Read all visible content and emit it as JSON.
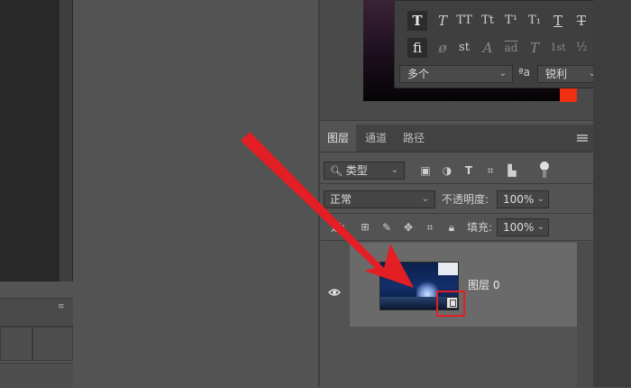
{
  "character_popup": {
    "top_row_glyphs": [
      "T",
      "T",
      "TT",
      "Tt",
      "T¹",
      "T₁",
      "T",
      "T"
    ],
    "bottom_row_glyphs": [
      "fi",
      "ø",
      "st",
      "A",
      "ad",
      "T",
      "1st",
      "½"
    ],
    "language_select": "多个",
    "aa_label": "ªa",
    "antialias_select": "锐利"
  },
  "layers_panel": {
    "tabs": [
      "图层",
      "通道",
      "路径"
    ],
    "filter_kind": "类型",
    "blend_mode": "正常",
    "opacity_label": "不透明度:",
    "opacity_value": "100%",
    "lock_label": "定:",
    "fill_label": "填充:",
    "fill_value": "100%",
    "layers": [
      {
        "name": "图层 0",
        "visible": true,
        "smart_object": true
      }
    ]
  },
  "colors": {
    "foreground_swatch": "#f02e10",
    "annotation_red": "#e31e24"
  }
}
